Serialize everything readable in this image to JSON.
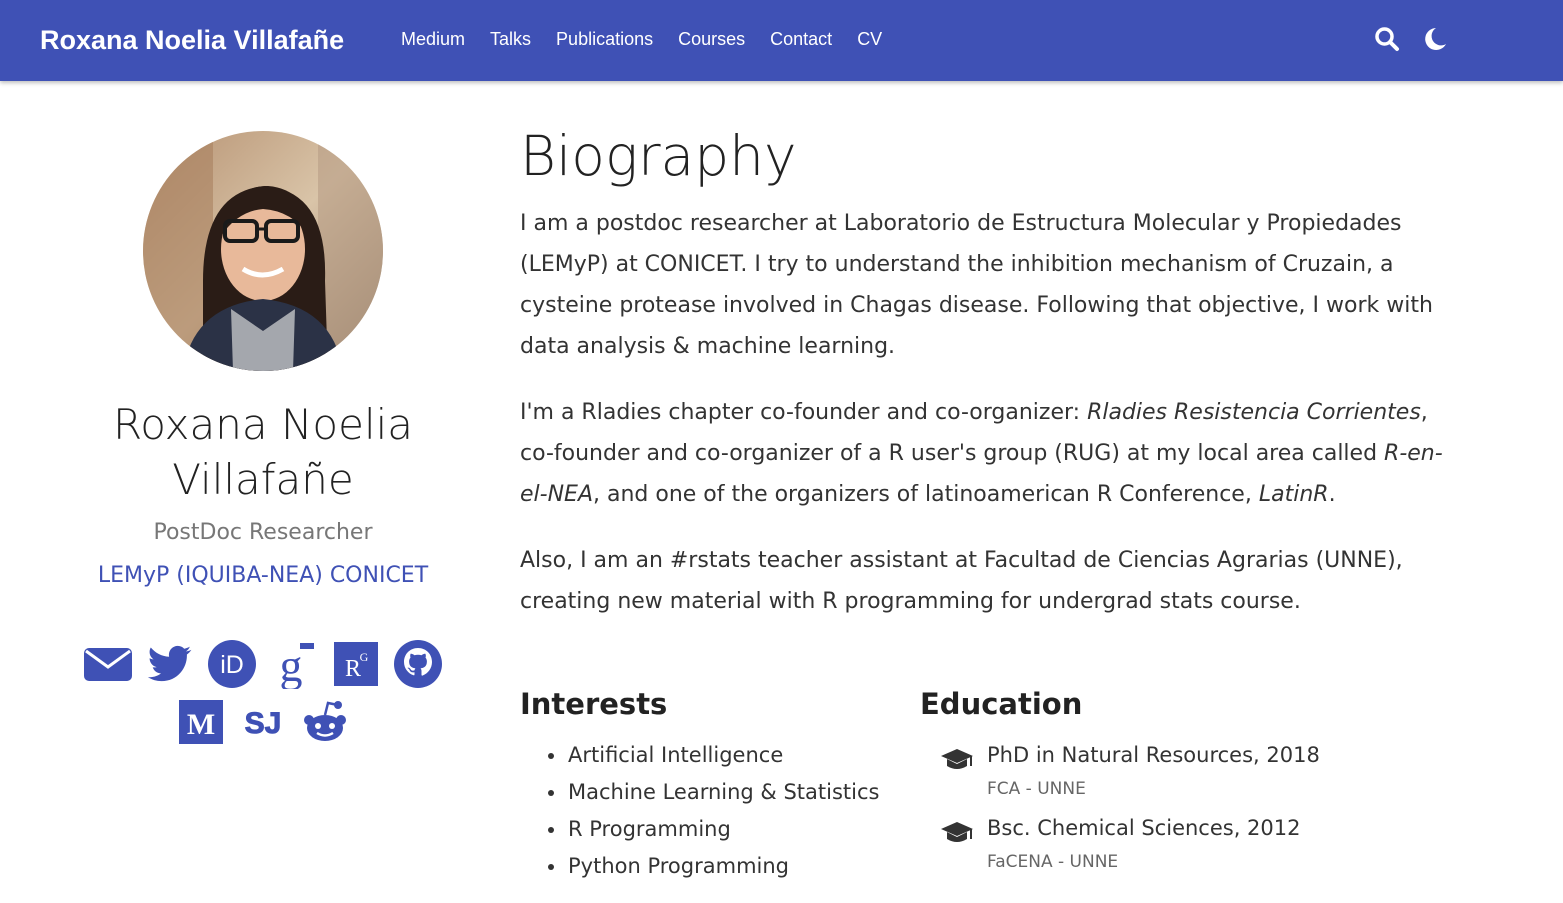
{
  "navbar": {
    "brand": "Roxana Noelia Villafañe",
    "links": [
      "Medium",
      "Talks",
      "Publications",
      "Courses",
      "Contact",
      "CV"
    ],
    "icons": [
      "search-icon",
      "moon-icon"
    ]
  },
  "profile": {
    "name": "Roxana Noelia Villafañe",
    "role": "PostDoc Researcher",
    "organization": "LEMyP (IQUIBA-NEA) CONICET",
    "social_icons": [
      "envelope-icon",
      "twitter-icon",
      "orcid-icon",
      "google-scholar-icon",
      "researchgate-icon",
      "github-icon",
      "medium-icon",
      "stackoverflow-icon",
      "reddit-icon"
    ]
  },
  "biography": {
    "title": "Biography",
    "p1": "I am a postdoc researcher at Laboratorio de Estructura Molecular y Propiedades (LEMyP) at CONICET. I try to understand the inhibition mechanism of Cruzain, a cysteine protease involved in Chagas disease. Following that objective, I work with data analysis & machine learning.",
    "p2_a": "I'm a Rladies chapter co-founder and co-organizer: ",
    "p2_b": "Rladies Resistencia Corrientes",
    "p2_c": ", co-founder and co-organizer of a R user's group (RUG) at my local area called ",
    "p2_d": "R-en-el-NEA",
    "p2_e": ", and one of the organizers of latinoamerican R Conference, ",
    "p2_f": "LatinR",
    "p2_g": ".",
    "p3": "Also, I am an #rstats teacher assistant at Facultad de Ciencias Agrarias (UNNE), creating new material with R programming for undergrad stats course."
  },
  "interests": {
    "title": "Interests",
    "items": [
      "Artificial Intelligence",
      "Machine Learning & Statistics",
      "R Programming",
      "Python Programming"
    ]
  },
  "education": {
    "title": "Education",
    "items": [
      {
        "course": "PhD in Natural Resources, 2018",
        "institution": "FCA - UNNE"
      },
      {
        "course": "Bsc. Chemical Sciences, 2012",
        "institution": "FaCENA - UNNE"
      }
    ]
  },
  "colors": {
    "primary": "#3f51b5",
    "text": "#333333",
    "muted": "#777777"
  }
}
